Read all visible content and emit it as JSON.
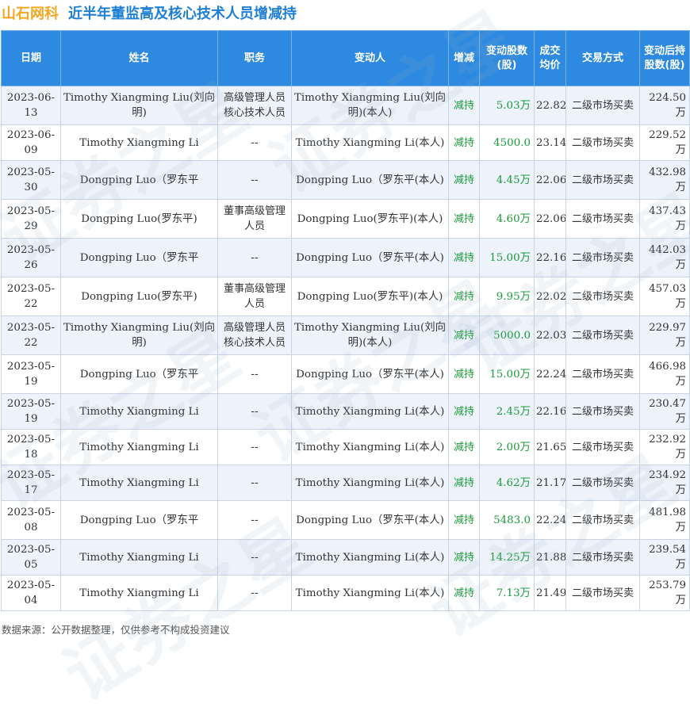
{
  "header": {
    "brand": "山石网科",
    "title": "近半年董监高及核心技术人员增减持"
  },
  "table": {
    "columns": [
      "日期",
      "姓名",
      "职务",
      "变动人",
      "增减",
      "变动股数(股)",
      "成交均价",
      "交易方式",
      "变动后持股数(股)"
    ],
    "rows": [
      {
        "date": "2023-06-13",
        "name": "Timothy Xiangming Liu(刘向明)",
        "role": "高级管理人员核心技术人员",
        "changer": "Timothy Xiangming Liu(刘向明)(本人)",
        "dir": "减持",
        "shares": "5.03万",
        "price": "22.82",
        "method": "二级市场买卖",
        "holding": "224.50万"
      },
      {
        "date": "2023-06-09",
        "name": "Timothy Xiangming Li",
        "role": "--",
        "changer": "Timothy Xiangming Li(本人)",
        "dir": "减持",
        "shares": "4500.0",
        "price": "23.14",
        "method": "二级市场买卖",
        "holding": "229.52万"
      },
      {
        "date": "2023-05-30",
        "name": "Dongping Luo（罗东平",
        "role": "--",
        "changer": "Dongping Luo（罗东平(本人)",
        "dir": "减持",
        "shares": "4.45万",
        "price": "22.06",
        "method": "二级市场买卖",
        "holding": "432.98万"
      },
      {
        "date": "2023-05-29",
        "name": "Dongping Luo(罗东平)",
        "role": "董事高级管理人员",
        "changer": "Dongping Luo(罗东平)(本人)",
        "dir": "减持",
        "shares": "4.60万",
        "price": "22.06",
        "method": "二级市场买卖",
        "holding": "437.43万"
      },
      {
        "date": "2023-05-26",
        "name": "Dongping Luo（罗东平",
        "role": "--",
        "changer": "Dongping Luo（罗东平(本人)",
        "dir": "减持",
        "shares": "15.00万",
        "price": "22.16",
        "method": "二级市场买卖",
        "holding": "442.03万"
      },
      {
        "date": "2023-05-22",
        "name": "Dongping Luo(罗东平)",
        "role": "董事高级管理人员",
        "changer": "Dongping Luo(罗东平)(本人)",
        "dir": "减持",
        "shares": "9.95万",
        "price": "22.02",
        "method": "二级市场买卖",
        "holding": "457.03万"
      },
      {
        "date": "2023-05-22",
        "name": "Timothy Xiangming Liu(刘向明)",
        "role": "高级管理人员核心技术人员",
        "changer": "Timothy Xiangming Liu(刘向明)(本人)",
        "dir": "减持",
        "shares": "5000.0",
        "price": "22.03",
        "method": "二级市场买卖",
        "holding": "229.97万"
      },
      {
        "date": "2023-05-19",
        "name": "Dongping Luo（罗东平",
        "role": "--",
        "changer": "Dongping Luo（罗东平(本人)",
        "dir": "减持",
        "shares": "15.00万",
        "price": "22.24",
        "method": "二级市场买卖",
        "holding": "466.98万"
      },
      {
        "date": "2023-05-19",
        "name": "Timothy Xiangming Li",
        "role": "--",
        "changer": "Timothy Xiangming Li(本人)",
        "dir": "减持",
        "shares": "2.45万",
        "price": "22.16",
        "method": "二级市场买卖",
        "holding": "230.47万"
      },
      {
        "date": "2023-05-18",
        "name": "Timothy Xiangming Li",
        "role": "--",
        "changer": "Timothy Xiangming Li(本人)",
        "dir": "减持",
        "shares": "2.00万",
        "price": "21.65",
        "method": "二级市场买卖",
        "holding": "232.92万"
      },
      {
        "date": "2023-05-17",
        "name": "Timothy Xiangming Li",
        "role": "--",
        "changer": "Timothy Xiangming Li(本人)",
        "dir": "减持",
        "shares": "4.62万",
        "price": "21.17",
        "method": "二级市场买卖",
        "holding": "234.92万"
      },
      {
        "date": "2023-05-08",
        "name": "Dongping Luo（罗东平",
        "role": "--",
        "changer": "Dongping Luo（罗东平(本人)",
        "dir": "减持",
        "shares": "5483.0",
        "price": "22.24",
        "method": "二级市场买卖",
        "holding": "481.98万"
      },
      {
        "date": "2023-05-05",
        "name": "Timothy Xiangming Li",
        "role": "--",
        "changer": "Timothy Xiangming Li(本人)",
        "dir": "减持",
        "shares": "14.25万",
        "price": "21.88",
        "method": "二级市场买卖",
        "holding": "239.54万"
      },
      {
        "date": "2023-05-04",
        "name": "Timothy Xiangming Li",
        "role": "--",
        "changer": "Timothy Xiangming Li(本人)",
        "dir": "减持",
        "shares": "7.13万",
        "price": "21.49",
        "method": "二级市场买卖",
        "holding": "253.79万"
      }
    ]
  },
  "footer": "数据来源：公开数据整理，仅供参考不构成投资建议",
  "watermark": "证券之星",
  "colors": {
    "brand": "#f5a623",
    "title": "#1e7fd6",
    "header_bg": "#2e8ae0",
    "decrease": "#1a9b3b"
  }
}
